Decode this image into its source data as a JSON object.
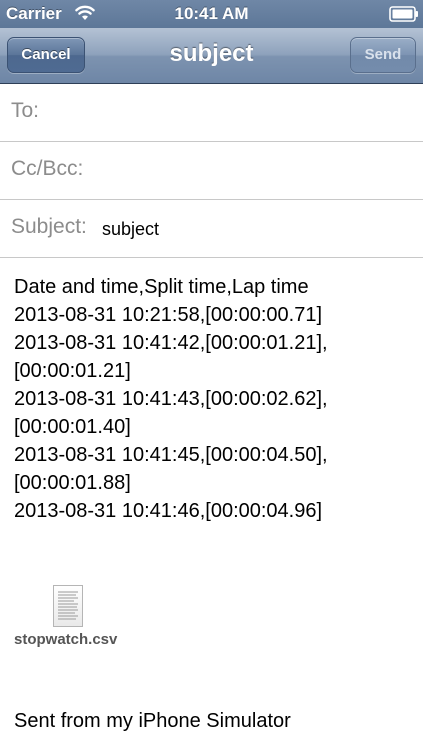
{
  "status_bar": {
    "carrier": "Carrier",
    "time": "10:41 AM",
    "icons": [
      "wifi-icon",
      "battery-icon"
    ]
  },
  "nav_bar": {
    "title": "subject",
    "cancel_label": "Cancel",
    "send_label": "Send"
  },
  "fields": {
    "to_label": "To:",
    "cc_label": "Cc/Bcc:",
    "subject_label": "Subject:",
    "subject_value": "subject"
  },
  "body": {
    "lines": [
      "Date and time,Split time,Lap time",
      "2013-08-31 10:21:58,[00:00:00.71]",
      "2013-08-31 10:41:42,[00:00:01.21],",
      "[00:00:01.21]",
      "2013-08-31 10:41:43,[00:00:02.62],",
      "[00:00:01.40]",
      "2013-08-31 10:41:45,[00:00:04.50],",
      "[00:00:01.88]",
      "2013-08-31 10:41:46,[00:00:04.96]"
    ]
  },
  "attachment": {
    "filename": "stopwatch.csv",
    "icon": "document-icon"
  },
  "signature": "Sent from my iPhone Simulator",
  "colors": {
    "nav_bar": "#7d93b0",
    "label_gray": "#8c8c8c"
  }
}
